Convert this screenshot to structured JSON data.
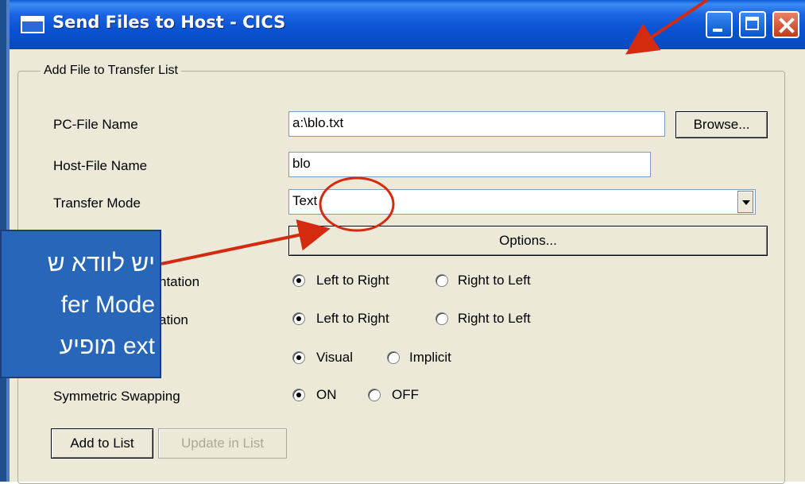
{
  "window": {
    "title": "Send Files to Host - CICS"
  },
  "group": {
    "legend": "Add File to Transfer List"
  },
  "fields": {
    "pc_file_label": "PC-File Name",
    "pc_file_value": "a:\\blo.txt",
    "browse_label": "Browse...",
    "host_file_label": "Host-File Name",
    "host_file_value": "blo",
    "transfer_mode_label": "Transfer Mode",
    "transfer_mode_value": "Text",
    "options_label": "Options..."
  },
  "radio_rows": [
    {
      "label": "ntation",
      "options": [
        "Left to Right",
        "Right to Left"
      ],
      "selected": 0
    },
    {
      "label": "ation",
      "options": [
        "Left to Right",
        "Right to Left"
      ],
      "selected": 0
    },
    {
      "label": "",
      "options": [
        "Visual",
        "Implicit"
      ],
      "selected": 0
    },
    {
      "label": "Symmetric Swapping",
      "options": [
        "ON",
        "OFF"
      ],
      "selected": 0
    }
  ],
  "buttons": {
    "add_to_list": "Add to List",
    "update_in_list": "Update in List"
  },
  "callout": {
    "lines": [
      "יש לוודא ש",
      "fer Mode",
      "מופיע  ext"
    ]
  },
  "colors": {
    "annotation_red": "#d42a10",
    "callout_bg": "#2766b8",
    "titlebar": "#0a52d0"
  }
}
